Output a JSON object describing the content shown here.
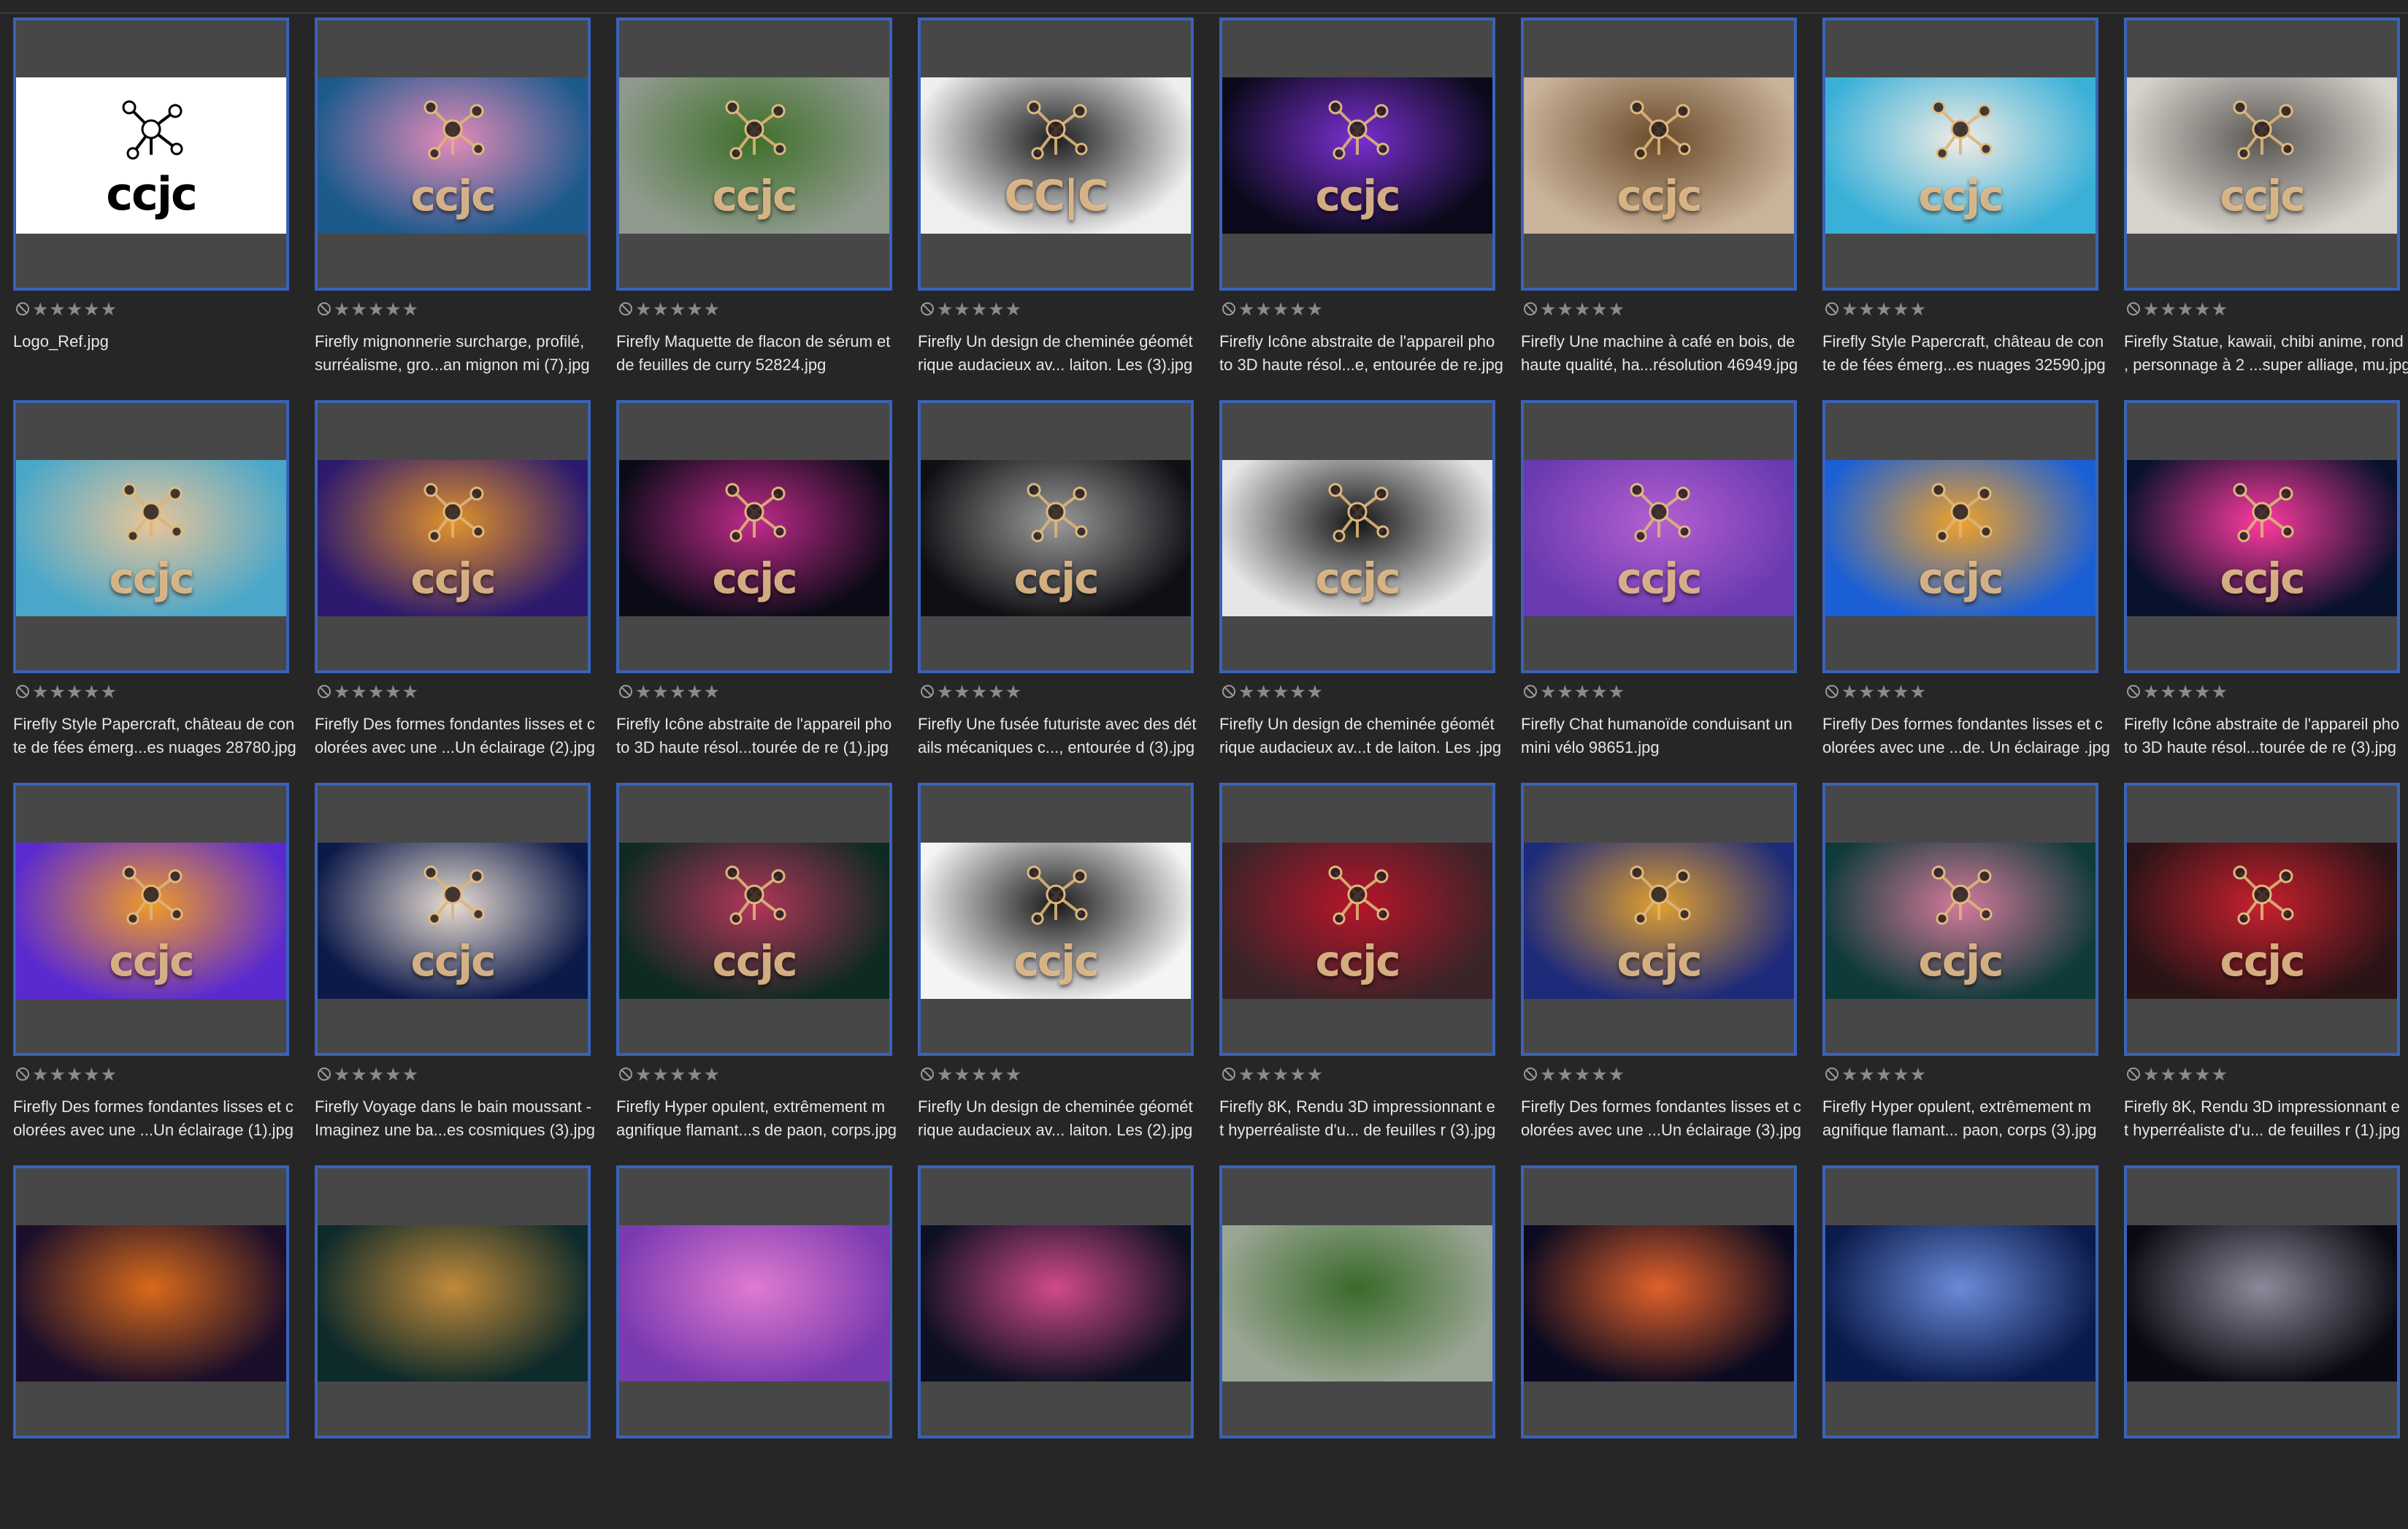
{
  "grid": {
    "items": [
      {
        "name": "Logo_Ref.jpg",
        "logo": "ccjc",
        "bg": [
          "#ffffff",
          "#ffffff"
        ],
        "white": true
      },
      {
        "name": "Firefly mignonnerie surcharge, profilé,\nsurréalisme, gro...an mignon mi (7).jpg",
        "logo": "ccjc",
        "bg": [
          "#1c5a8c",
          "#e48bb8"
        ]
      },
      {
        "name": "Firefly Maquette de flacon de sérum et\n de feuilles de curry 52824.jpg",
        "logo": "ccjc",
        "bg": [
          "#8e9a8c",
          "#3f6f2a"
        ]
      },
      {
        "name": "Firefly Un design de cheminée géomét\nrique audacieux av... laiton. Les  (3).jpg",
        "logo": "CC|C",
        "bg": [
          "#efefef",
          "#1e1e1e"
        ]
      },
      {
        "name": "Firefly Icône abstraite de l'appareil pho\nto 3D haute résol...e, entourée de re.jpg",
        "logo": "ccjc",
        "bg": [
          "#0a0a1a",
          "#7a2fd0"
        ]
      },
      {
        "name": "Firefly Une machine à café en bois, de\n haute qualité, ha...résolution 46949.jpg",
        "logo": "ccjc",
        "bg": [
          "#c9b39a",
          "#6a4a2a"
        ]
      },
      {
        "name": "Firefly Style Papercraft, château de con\nte de fées émerg...es nuages 32590.jpg",
        "logo": "ccjc",
        "bg": [
          "#3ab0d8",
          "#f1ece4"
        ]
      },
      {
        "name": "Firefly Statue, kawaii, chibi anime, rond\n, personnage à 2 ...super alliage, mu.jpg",
        "logo": "ccjc",
        "bg": [
          "#d6d2cc",
          "#5b5753"
        ]
      },
      {
        "name": "Firefly Style Papercraft, château de con\nte de fées émerg...es nuages 28780.jpg",
        "logo": "ccjc",
        "bg": [
          "#4aa7c9",
          "#e8c59a"
        ]
      },
      {
        "name": "Firefly Des formes fondantes lisses et c\nolorées avec une ...Un éclairage  (2).jpg",
        "logo": "ccjc",
        "bg": [
          "#2d1a6e",
          "#e2922a"
        ]
      },
      {
        "name": "Firefly Icône abstraite de l'appareil pho\nto 3D haute résol...tourée de re (1).jpg",
        "logo": "ccjc",
        "bg": [
          "#0b0b17",
          "#c02a8a"
        ]
      },
      {
        "name": "Firefly Une fusée futuriste avec des dét\nails mécaniques c..., entourée d (3).jpg",
        "logo": "ccjc",
        "bg": [
          "#101014",
          "#9a9a9a"
        ]
      },
      {
        "name": "Firefly Un design de cheminée géomét\nrique audacieux av...t de laiton. Les .jpg",
        "logo": "ccjc",
        "bg": [
          "#e6e6e6",
          "#141414"
        ]
      },
      {
        "name": "Firefly Chat humanoïde conduisant un\nmini vélo 98651.jpg",
        "logo": "ccjc",
        "bg": [
          "#6a3ab0",
          "#b45fd0"
        ]
      },
      {
        "name": "Firefly Des formes fondantes lisses et c\nolorées avec une ...de. Un éclairage .jpg",
        "logo": "ccjc",
        "bg": [
          "#1a5fd6",
          "#f0a12a"
        ]
      },
      {
        "name": "Firefly Icône abstraite de l'appareil pho\nto 3D haute résol...tourée de re (3).jpg",
        "logo": "ccjc",
        "bg": [
          "#08122a",
          "#ff3aa0"
        ]
      },
      {
        "name": "Firefly Des formes fondantes lisses et c\nolorées avec une ...Un éclairage  (1).jpg",
        "logo": "ccjc",
        "bg": [
          "#5a2ad0",
          "#f09a2a"
        ]
      },
      {
        "name": "Firefly Voyage dans le bain moussant -\n Imaginez une ba...es cosmiques (3).jpg",
        "logo": "ccjc",
        "bg": [
          "#0c1a4a",
          "#e8dcd0"
        ]
      },
      {
        "name": "Firefly Hyper opulent, extrêmement m\nagnifique flamant...s de paon, corps.jpg",
        "logo": "ccjc",
        "bg": [
          "#0f2a22",
          "#b2355a"
        ]
      },
      {
        "name": "Firefly Un design de cheminée géomét\nrique audacieux av... laiton. Les  (2).jpg",
        "logo": "ccjc",
        "bg": [
          "#f4f4f4",
          "#1a1a1a"
        ]
      },
      {
        "name": "Firefly 8K, Rendu 3D impressionnant e\nt hyperréaliste d'u... de feuilles r (3).jpg",
        "logo": "ccjc",
        "bg": [
          "#3a2428",
          "#b8142a"
        ]
      },
      {
        "name": "Firefly Des formes fondantes lisses et c\nolorées avec une ...Un éclairage  (3).jpg",
        "logo": "ccjc",
        "bg": [
          "#1e2a7a",
          "#e0a030"
        ]
      },
      {
        "name": "Firefly Hyper opulent, extrêmement m\nagnifique flamant... paon, corps (3).jpg",
        "logo": "ccjc",
        "bg": [
          "#0e3a3a",
          "#d47a9a"
        ]
      },
      {
        "name": "Firefly 8K, Rendu 3D impressionnant e\nt hyperréaliste d'u... de feuilles r (1).jpg",
        "logo": "ccjc",
        "bg": [
          "#2a1416",
          "#c8202e"
        ]
      },
      {
        "name": "",
        "logo": "",
        "bg": [
          "#1a0e2a",
          "#d86a1a"
        ]
      },
      {
        "name": "",
        "logo": "",
        "bg": [
          "#0e2a2a",
          "#c08a3a"
        ]
      },
      {
        "name": "",
        "logo": "",
        "bg": [
          "#7a3ab0",
          "#e07ad0"
        ]
      },
      {
        "name": "",
        "logo": "",
        "bg": [
          "#0c1020",
          "#d04a8a"
        ]
      },
      {
        "name": "",
        "logo": "",
        "bg": [
          "#9aa694",
          "#3a6a2a"
        ]
      },
      {
        "name": "",
        "logo": "",
        "bg": [
          "#0a0a20",
          "#e0602a"
        ]
      },
      {
        "name": "",
        "logo": "",
        "bg": [
          "#0a1a4a",
          "#6a8ad8"
        ]
      },
      {
        "name": "",
        "logo": "",
        "bg": [
          "#0a0a12",
          "#8a8a9a"
        ]
      }
    ]
  },
  "rating": {
    "stars": "★★★★★"
  }
}
